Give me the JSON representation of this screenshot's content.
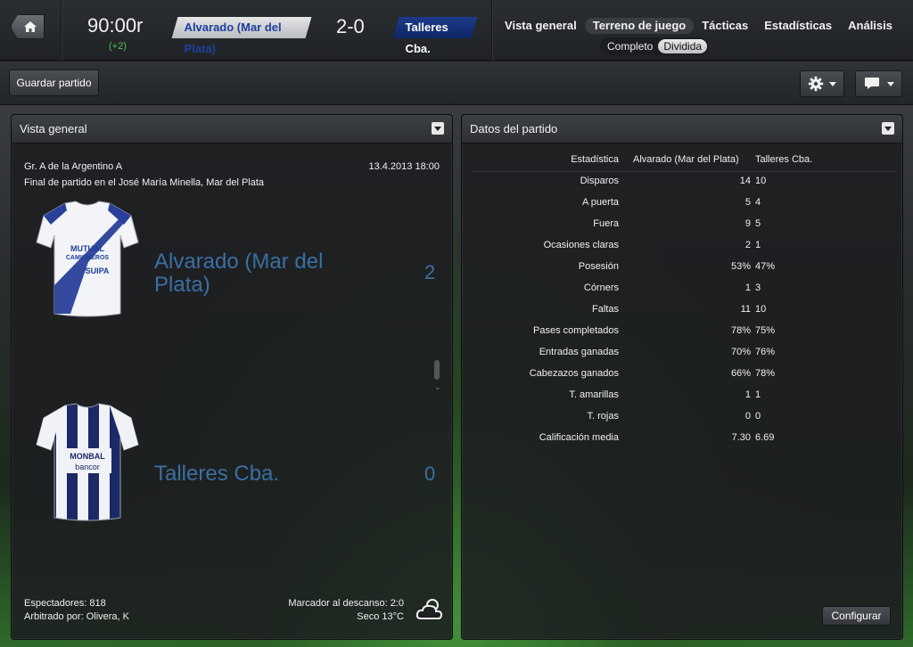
{
  "header": {
    "time": "90:00r",
    "added_time": "(+2)",
    "home_team": "Alvarado (Mar del Plata)",
    "score": "2-0",
    "away_team": "Talleres Cba.",
    "nav": [
      "Vista general",
      "Terreno de juego",
      "Tácticas",
      "Estadísticas",
      "Análisis"
    ],
    "active_nav": "Terreno de juego",
    "subnav": [
      "Completo",
      "Dividida"
    ],
    "active_subnav": "Dividida"
  },
  "toolbar": {
    "save_label": "Guardar partido",
    "settings_icon": "gear-icon",
    "chat_icon": "speech-bubble-icon"
  },
  "overview": {
    "title": "Vista general",
    "competition": "Gr. A de la Argentino A",
    "datetime": "13.4.2013 18:00",
    "status": "Final de partido en el José María Minella, Mar del Plata",
    "home": {
      "name": "Alvarado (Mar del Plata)",
      "score": "2",
      "shirt_sponsor": [
        "MUTUAL",
        "CAMIONEROS",
        "SUIPA"
      ]
    },
    "away": {
      "name": "Talleres Cba.",
      "score": "0",
      "shirt_sponsor": [
        "MONBAL",
        "bancor"
      ]
    },
    "attendance": "Espectadores: 818",
    "referee": "Arbitrado por: Olivera, K",
    "halftime": "Marcador al descanso: 2:0",
    "weather": "Seco 13°C",
    "weather_icon": "partly-cloudy-icon"
  },
  "match_data": {
    "title": "Datos del partido",
    "columns": [
      "Estadística",
      "Alvarado (Mar del Plata)",
      "Talleres Cba."
    ],
    "rows": [
      {
        "label": "Disparos",
        "home": "14",
        "away": "10"
      },
      {
        "label": "A puerta",
        "home": "5",
        "away": "4"
      },
      {
        "label": "Fuera",
        "home": "9",
        "away": "5"
      },
      {
        "label": "Ocasiones claras",
        "home": "2",
        "away": "1"
      },
      {
        "label": "Posesión",
        "home": "53%",
        "away": "47%"
      },
      {
        "label": "Córners",
        "home": "1",
        "away": "3"
      },
      {
        "label": "Faltas",
        "home": "11",
        "away": "10"
      },
      {
        "label": "Pases completados",
        "home": "78%",
        "away": "75%"
      },
      {
        "label": "Entradas ganadas",
        "home": "70%",
        "away": "76%"
      },
      {
        "label": "Cabezazos ganados",
        "home": "66%",
        "away": "78%"
      },
      {
        "label": "T. amarillas",
        "home": "1",
        "away": "1"
      },
      {
        "label": "T. rojas",
        "home": "0",
        "away": "0"
      },
      {
        "label": "Calificación media",
        "home": "7.30",
        "away": "6.69"
      }
    ],
    "configure_label": "Configurar"
  }
}
